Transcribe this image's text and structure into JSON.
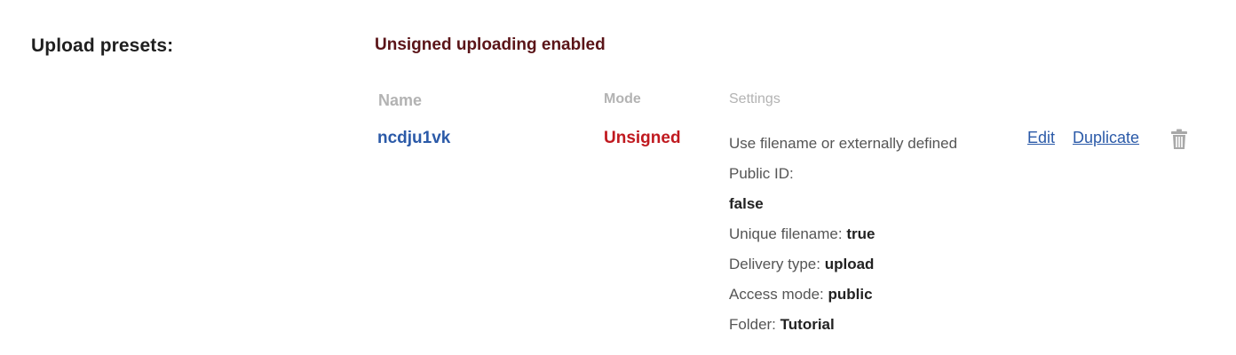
{
  "section": {
    "label": "Upload presets:",
    "status": "Unsigned uploading enabled"
  },
  "table": {
    "headers": {
      "name": "Name",
      "mode": "Mode",
      "settings": "Settings"
    },
    "rows": [
      {
        "name": "ncdju1vk",
        "mode": "Unsigned",
        "settings": {
          "line1": "Use filename or externally defined",
          "public_id_label": "Public ID:",
          "public_id_value": "false",
          "unique_filename_label": "Unique filename:",
          "unique_filename_value": "true",
          "delivery_type_label": "Delivery type:",
          "delivery_type_value": "upload",
          "access_mode_label": "Access mode:",
          "access_mode_value": "public",
          "folder_label": "Folder:",
          "folder_value": "Tutorial"
        },
        "actions": {
          "edit": "Edit",
          "duplicate": "Duplicate",
          "delete_icon": "trash-icon"
        }
      }
    ]
  },
  "colors": {
    "status_dark_red": "#5a1418",
    "mode_red": "#c0191f",
    "link_blue": "#2b5aa8",
    "header_gray": "#b3b3b3",
    "icon_gray": "#a8a8a8"
  }
}
